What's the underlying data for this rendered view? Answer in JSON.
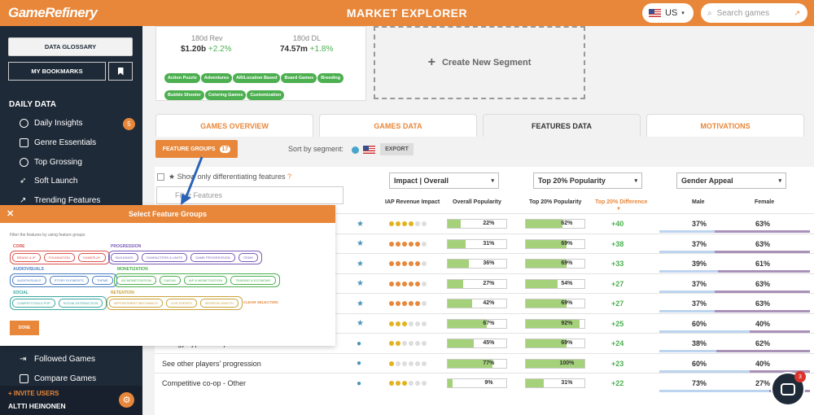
{
  "header": {
    "logo": "GameRefinery",
    "title": "MARKET EXPLORER",
    "country": "US",
    "search_placeholder": "Search games"
  },
  "sidebar": {
    "glossary": "DATA GLOSSARY",
    "bookmarks": "MY BOOKMARKS",
    "section": "DAILY DATA",
    "items": [
      {
        "label": "Daily Insights",
        "badge": "5"
      },
      {
        "label": "Genre Essentials"
      },
      {
        "label": "Top Grossing"
      },
      {
        "label": "Soft Launch"
      },
      {
        "label": "Trending Features"
      }
    ],
    "bottom_items": [
      {
        "label": "Followed Games"
      },
      {
        "label": "Compare Games"
      }
    ],
    "invite": "+ INVITE USERS",
    "user": "ALTTI HEINONEN"
  },
  "segment": {
    "rev_label": "180d Rev",
    "rev_value": "$1.20b",
    "rev_change": "+2.2%",
    "dl_label": "180d DL",
    "dl_value": "74.57m",
    "dl_change": "+1.8%",
    "tags": [
      "Action Puzzle",
      "Adventures",
      "AR/Location Based",
      "Board Games",
      "Breeding",
      "Bubble Shooter",
      "Coloring Games",
      "Customization"
    ],
    "create": "Create New Segment"
  },
  "tabs": [
    "GAMES OVERVIEW",
    "GAMES DATA",
    "FEATURES DATA",
    "MOTIVATIONS"
  ],
  "toolbar": {
    "groups": "FEATURE GROUPS",
    "groups_count": "17",
    "sort_label": "Sort by segment:",
    "export": "EXPORT",
    "show_only": "Show only differentiating features",
    "filter_placeholder": "Filter Features"
  },
  "columns": {
    "sel1": "Impact | Overall",
    "sel2": "Top 20% Popularity",
    "sel3": "Gender Appeal",
    "h1": "IAP Revenue Impact",
    "h2": "Overall Popularity",
    "h3": "Top 20% Popularity",
    "h4": "Top 20% Difference",
    "h5": "Male",
    "h6": "Female"
  },
  "rows": [
    {
      "name": "",
      "dots": 4,
      "dcolor": "#e3b21f",
      "overall": "22%",
      "op": 0.22,
      "top": "62%",
      "tp": 0.62,
      "diff": "+40",
      "male": "37%",
      "female": "63%",
      "star": true
    },
    {
      "name": "",
      "dots": 5,
      "dcolor": "#e8873a",
      "overall": "31%",
      "op": 0.31,
      "top": "69%",
      "tp": 0.69,
      "diff": "+38",
      "male": "37%",
      "female": "63%",
      "star": true
    },
    {
      "name": "",
      "dots": 5,
      "dcolor": "#e8873a",
      "overall": "36%",
      "op": 0.36,
      "top": "69%",
      "tp": 0.69,
      "diff": "+33",
      "male": "39%",
      "female": "61%",
      "star": true
    },
    {
      "name": "",
      "dots": 5,
      "dcolor": "#e8873a",
      "overall": "27%",
      "op": 0.27,
      "top": "54%",
      "tp": 0.54,
      "diff": "+27",
      "male": "37%",
      "female": "63%",
      "star": true
    },
    {
      "name": "",
      "dots": 5,
      "dcolor": "#e8873a",
      "overall": "42%",
      "op": 0.42,
      "top": "69%",
      "tp": 0.69,
      "diff": "+27",
      "male": "37%",
      "female": "63%",
      "star": true
    },
    {
      "name": "",
      "dots": 3,
      "dcolor": "#e3b21f",
      "overall": "67%",
      "op": 0.67,
      "top": "92%",
      "tp": 0.92,
      "diff": "+25",
      "male": "60%",
      "female": "40%",
      "star": true
    },
    {
      "name": "Energy Type - Life points",
      "dots": 2,
      "dcolor": "#e3b21f",
      "overall": "45%",
      "op": 0.45,
      "top": "69%",
      "tp": 0.69,
      "diff": "+24",
      "male": "38%",
      "female": "62%",
      "star": false
    },
    {
      "name": "See other players' progression",
      "dots": 1,
      "dcolor": "#e3b21f",
      "overall": "77%",
      "op": 0.77,
      "top": "100%",
      "tp": 1.0,
      "diff": "+23",
      "male": "60%",
      "female": "40%",
      "star": false
    },
    {
      "name": "Competitive co-op - Other",
      "dots": 3,
      "dcolor": "#e3b21f",
      "overall": "9%",
      "op": 0.09,
      "top": "31%",
      "tp": 0.31,
      "diff": "+22",
      "male": "73%",
      "female": "27%",
      "star": false
    }
  ],
  "popup": {
    "title": "Select Feature Groups",
    "hint": "Filter the features by using feature groups",
    "core_label": "CORE",
    "core": [
      "BRAND & IP",
      "FOUNDATION",
      "GAMEPLAY"
    ],
    "prog_label": "PROGRESSION",
    "prog": [
      "BUILDINGS",
      "CHARACTERS & UNITS",
      "GAME PROGRESSION",
      "ITEMS"
    ],
    "av_label": "AUDIOVISUALS",
    "av": [
      "AUDIOVISUALS",
      "STORY ELEMENTS",
      "THEME"
    ],
    "mon_label": "MONETIZATION",
    "mon": [
      "AD MONETIZATION",
      "GACHA",
      "IAP & MONETIZATION",
      "TRADING & ECONOMY"
    ],
    "soc_label": "SOCIAL",
    "soc": [
      "COMPETITION & PVP",
      "SOCIAL INTERACTION"
    ],
    "ret_label": "RETENTION",
    "ret": [
      "APPOINTMENT MECHANICS",
      "LIVE EVENTS",
      "SESSION LENGTH"
    ],
    "clear": "CLEAR SELECTION",
    "done": "DONE"
  },
  "chat": {
    "badge": "3"
  }
}
